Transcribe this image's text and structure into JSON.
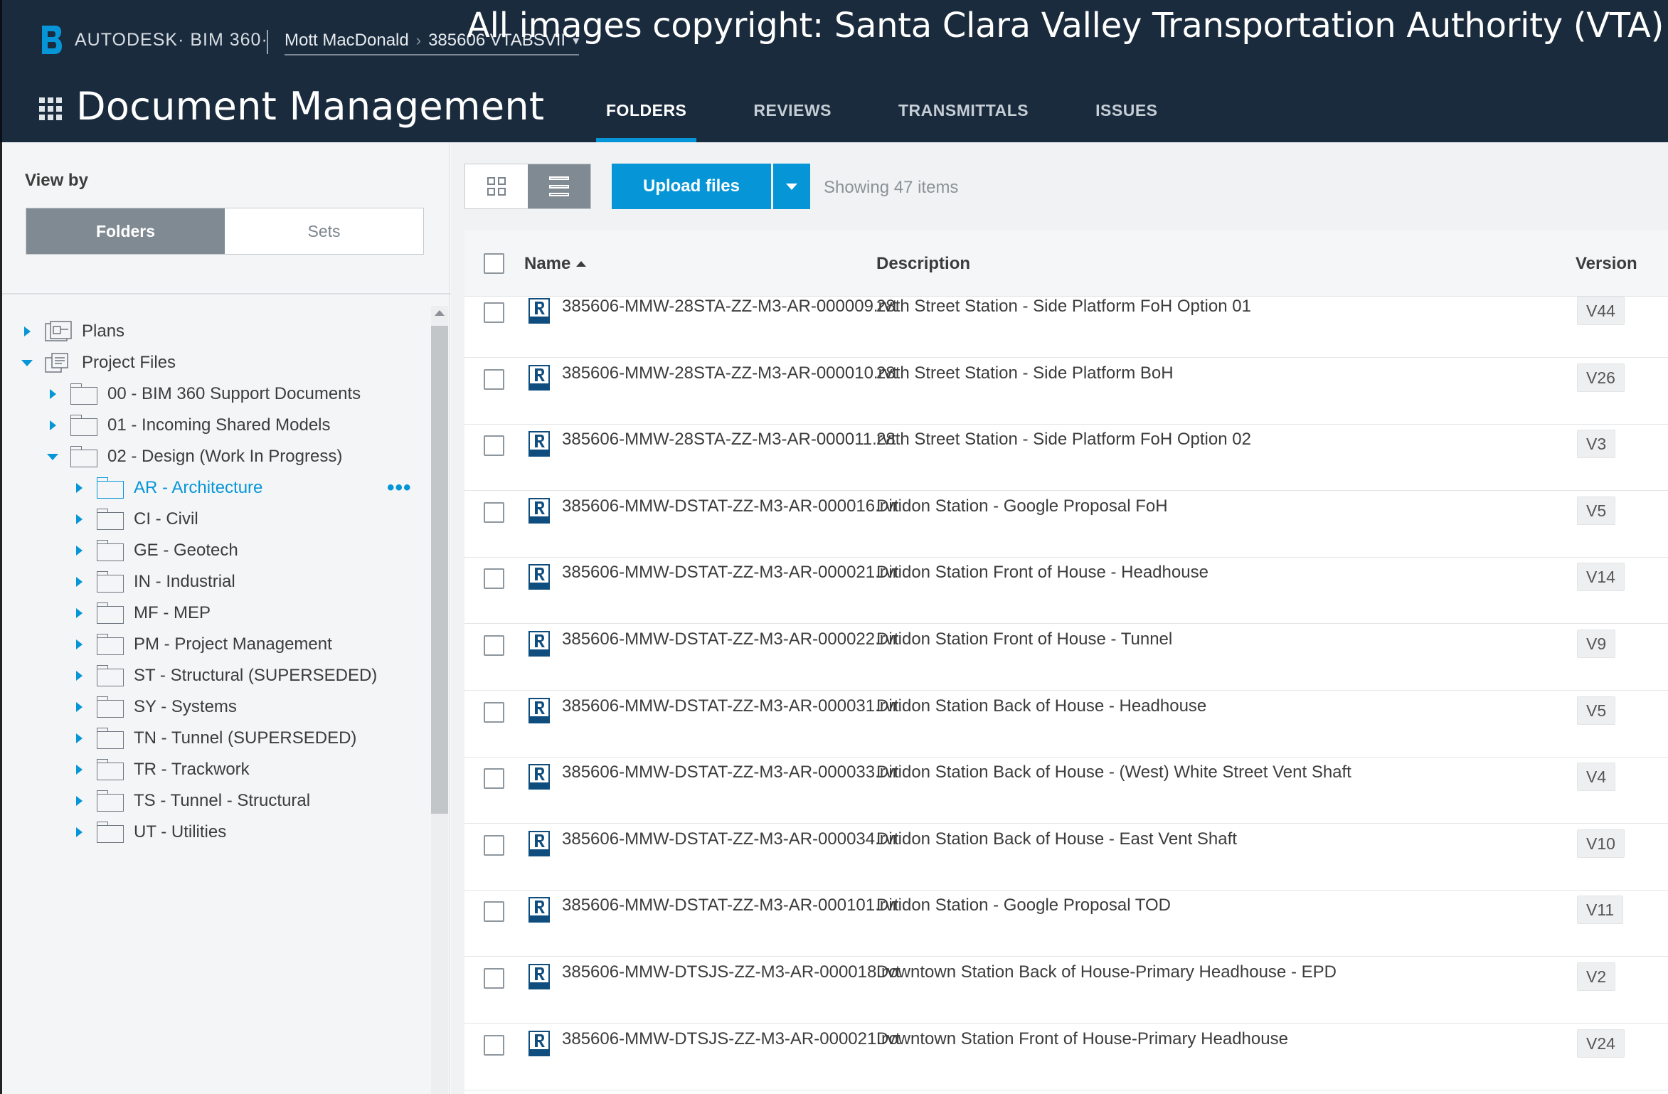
{
  "header": {
    "brand": "AUTODESK· BIM 360·",
    "breadcrumb_account": "Mott MacDonald",
    "breadcrumb_project": "385606 VTABSVII",
    "watermark": "All images copyright: Santa Clara Valley Transportation Authority (VTA)",
    "app_title": "Document Management",
    "tabs": [
      {
        "label": "FOLDERS",
        "active": true
      },
      {
        "label": "REVIEWS",
        "active": false
      },
      {
        "label": "TRANSMITTALS",
        "active": false
      },
      {
        "label": "ISSUES",
        "active": false
      }
    ]
  },
  "sidebar": {
    "view_by_label": "View by",
    "view_modes": [
      "Folders",
      "Sets"
    ],
    "selected_view_mode": "Folders",
    "tree": [
      {
        "label": "Plans",
        "expanded": false,
        "icon": "plans-icon"
      },
      {
        "label": "Project Files",
        "expanded": true,
        "icon": "project-files-icon"
      },
      {
        "label": "00 - BIM 360 Support Documents",
        "expanded": false,
        "icon": "folder-icon"
      },
      {
        "label": "01 - Incoming Shared Models",
        "expanded": false,
        "icon": "folder-icon"
      },
      {
        "label": "02 - Design (Work In Progress)",
        "expanded": true,
        "icon": "folder-icon"
      },
      {
        "label": "AR - Architecture",
        "expanded": false,
        "selected": true,
        "icon": "folder-icon"
      },
      {
        "label": "CI - Civil",
        "expanded": false,
        "icon": "folder-icon"
      },
      {
        "label": "GE - Geotech",
        "expanded": false,
        "icon": "folder-icon"
      },
      {
        "label": "IN - Industrial",
        "expanded": false,
        "icon": "folder-icon"
      },
      {
        "label": "MF - MEP",
        "expanded": false,
        "icon": "folder-icon"
      },
      {
        "label": "PM - Project Management",
        "expanded": false,
        "icon": "folder-icon"
      },
      {
        "label": "ST - Structural (SUPERSEDED)",
        "expanded": false,
        "icon": "folder-icon"
      },
      {
        "label": "SY - Systems",
        "expanded": false,
        "icon": "folder-icon"
      },
      {
        "label": "TN - Tunnel (SUPERSEDED)",
        "expanded": false,
        "icon": "folder-icon"
      },
      {
        "label": "TR - Trackwork",
        "expanded": false,
        "icon": "folder-icon"
      },
      {
        "label": "TS - Tunnel - Structural",
        "expanded": false,
        "icon": "folder-icon"
      },
      {
        "label": "UT - Utilities",
        "expanded": false,
        "icon": "folder-icon"
      }
    ],
    "more_actions": "•••"
  },
  "toolbar": {
    "upload_label": "Upload files",
    "showing_text": "Showing 47 items",
    "view_mode": "list"
  },
  "table": {
    "columns": [
      "Name",
      "Description",
      "Version"
    ],
    "sort_column": "Name",
    "sort_direction": "ascending",
    "rows": [
      {
        "name": "385606-MMW-28STA-ZZ-M3-AR-000009.rvt",
        "description": "28th Street Station - Side Platform FoH Option 01",
        "version": "V44"
      },
      {
        "name": "385606-MMW-28STA-ZZ-M3-AR-000010.rvt",
        "description": "28th Street Station - Side Platform BoH",
        "version": "V26"
      },
      {
        "name": "385606-MMW-28STA-ZZ-M3-AR-000011.rvt",
        "description": "28th Street Station - Side Platform FoH Option 02",
        "version": "V3"
      },
      {
        "name": "385606-MMW-DSTAT-ZZ-M3-AR-000016.rvt",
        "description": "Diridon Station - Google Proposal FoH",
        "version": "V5"
      },
      {
        "name": "385606-MMW-DSTAT-ZZ-M3-AR-000021.rvt",
        "description": "Diridon Station Front of House - Headhouse",
        "version": "V14"
      },
      {
        "name": "385606-MMW-DSTAT-ZZ-M3-AR-000022.rvt",
        "description": "Diridon Station Front of House - Tunnel",
        "version": "V9"
      },
      {
        "name": "385606-MMW-DSTAT-ZZ-M3-AR-000031.rvt",
        "description": "Diridon Station Back of House - Headhouse",
        "version": "V5"
      },
      {
        "name": "385606-MMW-DSTAT-ZZ-M3-AR-000033.rvt",
        "description": "Diridon Station Back of House - (West) White Street Vent Shaft",
        "version": "V4"
      },
      {
        "name": "385606-MMW-DSTAT-ZZ-M3-AR-000034.rvt",
        "description": "Diridon Station Back of House - East Vent Shaft",
        "version": "V10"
      },
      {
        "name": "385606-MMW-DSTAT-ZZ-M3-AR-000101.rvt",
        "description": "Diridon Station - Google Proposal TOD",
        "version": "V11"
      },
      {
        "name": "385606-MMW-DTSJS-ZZ-M3-AR-000018.rvt",
        "description": "Downtown Station Back of House-Primary Headhouse - EPD",
        "version": "V2"
      },
      {
        "name": "385606-MMW-DTSJS-ZZ-M3-AR-000021.rvt",
        "description": "Downtown Station Front of House-Primary Headhouse",
        "version": "V24"
      }
    ]
  },
  "colors": {
    "header_bg": "#1a2b3d",
    "accent": "#0696d7",
    "sidebar_bg": "#f4f5f6",
    "segment_active": "#808a93"
  }
}
